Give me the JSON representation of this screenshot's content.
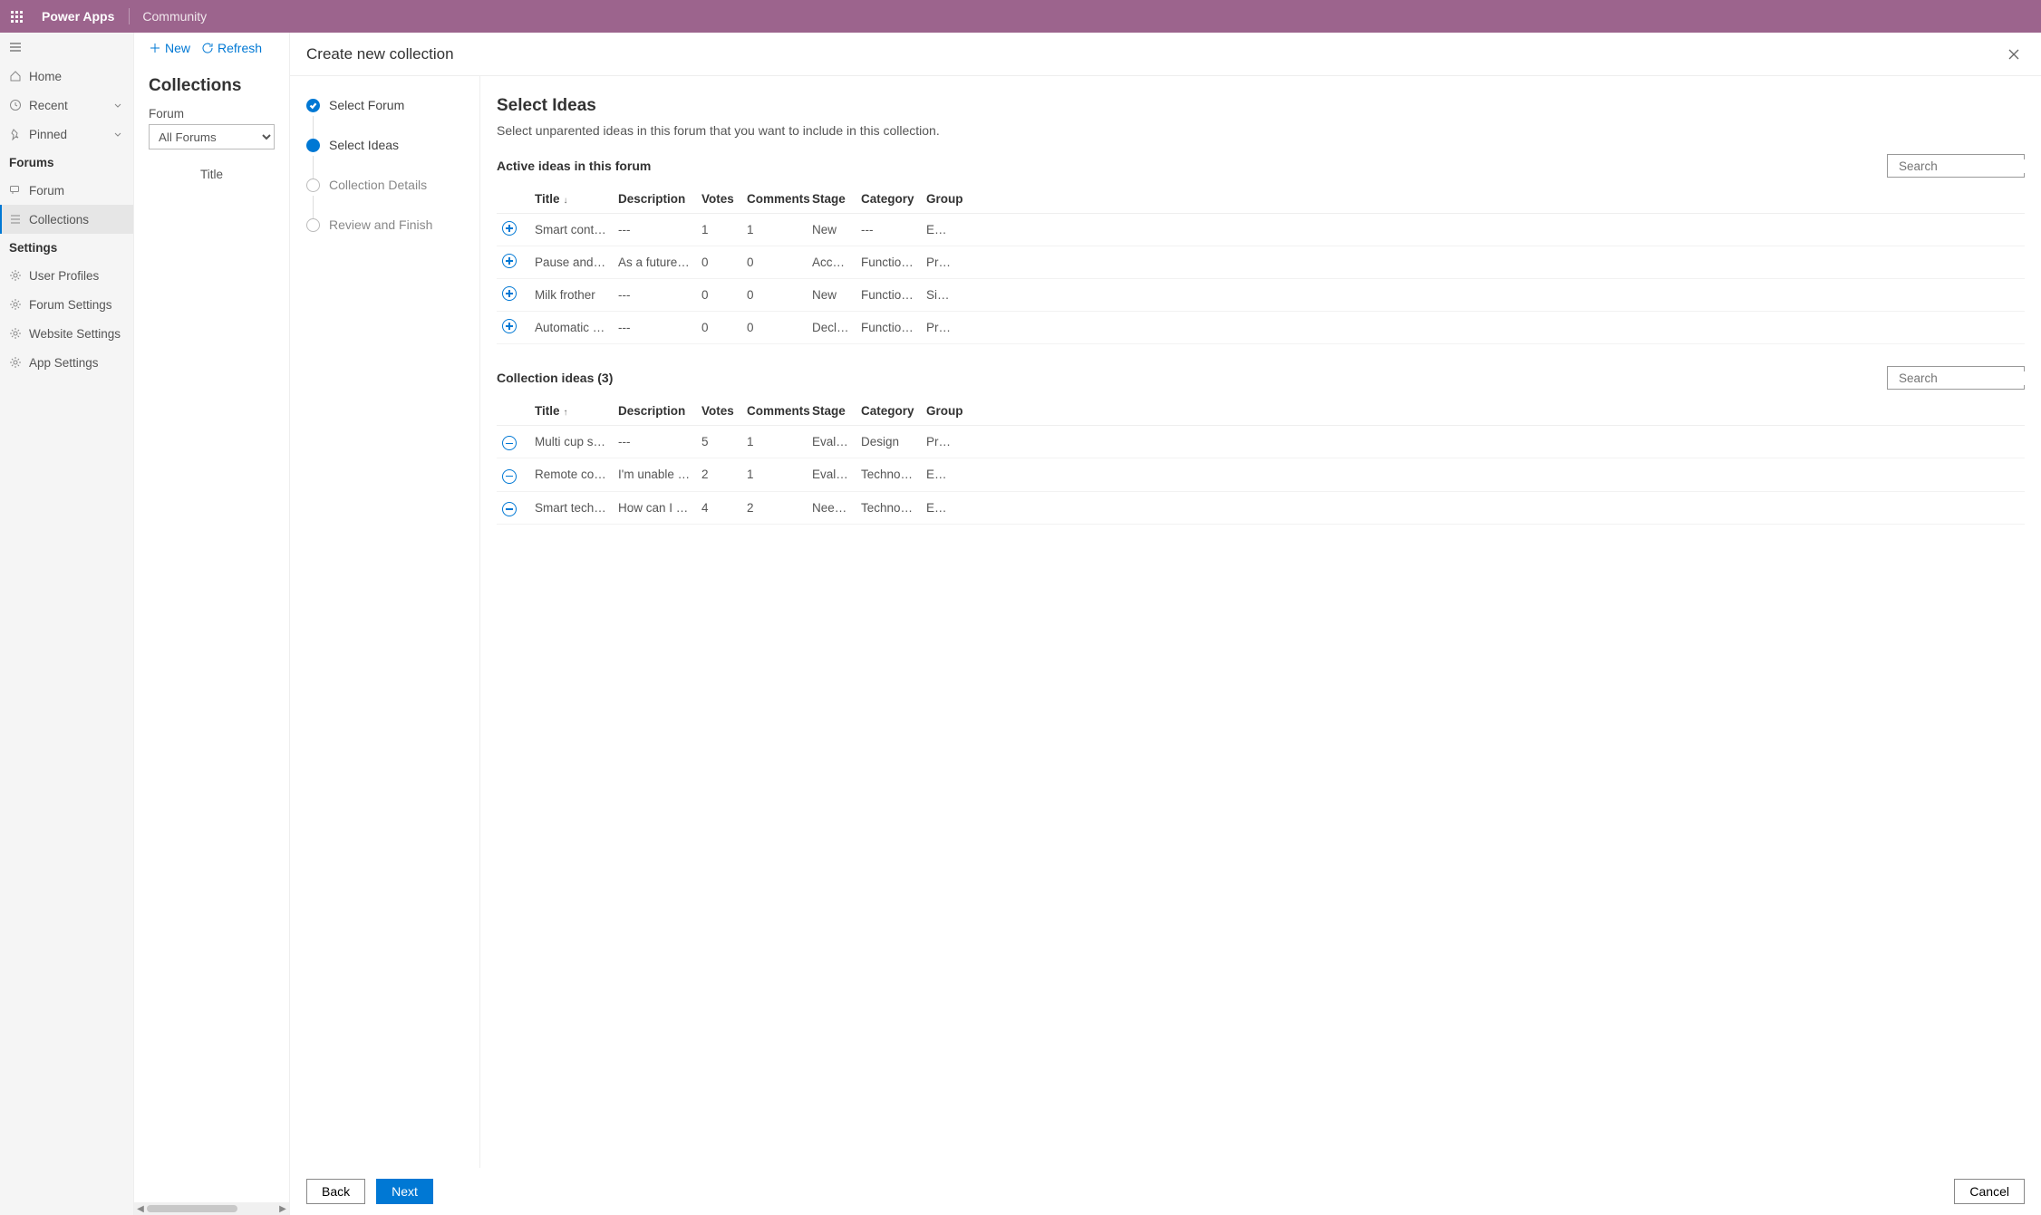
{
  "top": {
    "product": "Power Apps",
    "area": "Community"
  },
  "nav": {
    "home": "Home",
    "recent": "Recent",
    "pinned": "Pinned",
    "forumsSection": "Forums",
    "forum": "Forum",
    "collections": "Collections",
    "settingsSection": "Settings",
    "userProfiles": "User Profiles",
    "forumSettings": "Forum Settings",
    "websiteSettings": "Website Settings",
    "appSettings": "App Settings"
  },
  "panel2": {
    "new": "New",
    "refresh": "Refresh",
    "heading": "Collections",
    "forumLabel": "Forum",
    "forumValue": "All Forums",
    "titleCol": "Title"
  },
  "modal": {
    "title": "Create new collection",
    "steps": {
      "s1": "Select Forum",
      "s2": "Select Ideas",
      "s3": "Collection Details",
      "s4": "Review and Finish"
    },
    "content": {
      "heading": "Select Ideas",
      "desc": "Select unparented ideas in this forum that you want to include in this collection.",
      "activeLabel": "Active ideas in this forum",
      "collectionLabel": "Collection ideas (3)",
      "searchPlaceholder": "Search",
      "cols": {
        "title": "Title",
        "desc": "Description",
        "votes": "Votes",
        "comments": "Comments",
        "stage": "Stage",
        "category": "Category",
        "group": "Group"
      },
      "active": [
        {
          "title": "Smart control",
          "desc": "---",
          "votes": "1",
          "comments": "1",
          "stage": "New",
          "category": "---",
          "group": "Espres…"
        },
        {
          "title": "Pause and serve",
          "desc": "As a future fea…",
          "votes": "0",
          "comments": "0",
          "stage": "Accep…",
          "category": "Functional…",
          "group": "Precisi…"
        },
        {
          "title": "Milk frother",
          "desc": "---",
          "votes": "0",
          "comments": "0",
          "stage": "New",
          "category": "Functional…",
          "group": "Single…"
        },
        {
          "title": "Automatic shu…",
          "desc": "---",
          "votes": "0",
          "comments": "0",
          "stage": "Declin…",
          "category": "Functional…",
          "group": "Precisi…"
        }
      ],
      "collection": [
        {
          "title": "Multi cup setti…",
          "desc": "---",
          "votes": "5",
          "comments": "1",
          "stage": "Evalua…",
          "category": "Design",
          "group": "Precisi…"
        },
        {
          "title": "Remote control",
          "desc": "I'm unable to …",
          "votes": "2",
          "comments": "1",
          "stage": "Evalua…",
          "category": "Technology",
          "group": "Espres…"
        },
        {
          "title": "Smart technol…",
          "desc": "How can I bre…",
          "votes": "4",
          "comments": "2",
          "stage": "Needs…",
          "category": "Technology",
          "group": "Espres…"
        }
      ]
    },
    "footer": {
      "back": "Back",
      "next": "Next",
      "cancel": "Cancel"
    }
  }
}
